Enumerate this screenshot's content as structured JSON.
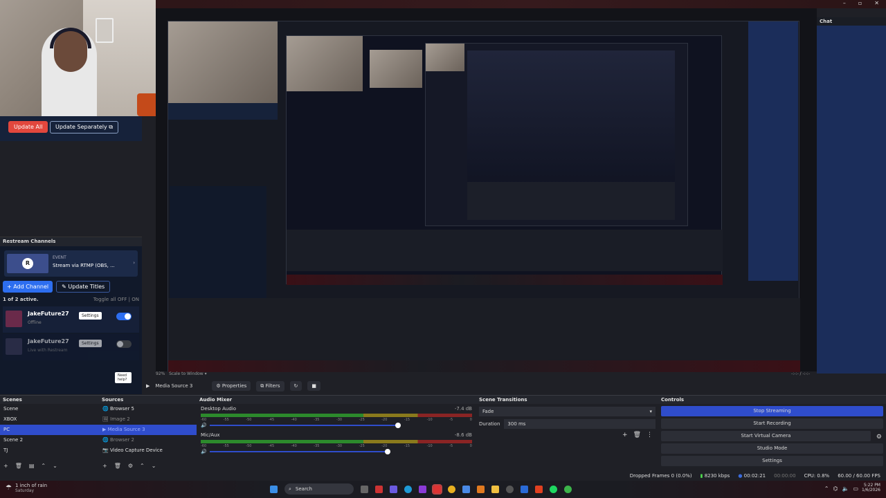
{
  "window": {
    "min": "–",
    "max": "▫",
    "close": "✕"
  },
  "update": {
    "update_all": "Update All",
    "update_separately": "Update Separately ⧉"
  },
  "restream": {
    "title": "Restream Channels",
    "event_label": "EVENT",
    "event_title": "Stream via RTMP (OBS, ...",
    "add_channel": "+ Add Channel",
    "update_titles": "✎ Update Titles",
    "active_count": "1 of 2 active.",
    "toggle_all": "Toggle all",
    "toggle_off": "OFF",
    "toggle_on": "ON",
    "channels": [
      {
        "name": "JakeFuture27",
        "status": "Offline",
        "settings": "Settings",
        "enabled": true
      },
      {
        "name": "JakeFuture27",
        "status": "Live with Restream",
        "settings": "Settings",
        "enabled": false
      }
    ],
    "help": "Need help?"
  },
  "chat": {
    "title": "Chat"
  },
  "toolbar": {
    "source_name": "Media Source 3",
    "properties": "Properties",
    "filters": "Filters",
    "zoom": "92%",
    "scale": "Scale to Window",
    "time": "-:-:- / -:-:-"
  },
  "scenes": {
    "title": "Scenes",
    "items": [
      "Scene",
      "XBOX",
      "PC",
      "Scene 2",
      "TJ"
    ],
    "selected": 2
  },
  "sources": {
    "title": "Sources",
    "items": [
      "Browser 5",
      "Image 2",
      "Media Source 3",
      "Browser 2",
      "Video Capture Device"
    ],
    "selected": 2
  },
  "audio": {
    "title": "Audio Mixer",
    "channels": [
      {
        "name": "Desktop Audio",
        "db": "-7.4 dB",
        "level": 0.55
      },
      {
        "name": "Mic/Aux",
        "db": "-8.6 dB",
        "level": 0.45
      }
    ],
    "ticks": [
      "-60",
      "-55",
      "-50",
      "-45",
      "-40",
      "-35",
      "-30",
      "-25",
      "-20",
      "-15",
      "-10",
      "-5",
      "0"
    ]
  },
  "transitions": {
    "title": "Scene Transitions",
    "type": "Fade",
    "duration_label": "Duration",
    "duration": "300 ms"
  },
  "controls": {
    "title": "Controls",
    "buttons": [
      "Stop Streaming",
      "Start Recording",
      "Start Virtual Camera",
      "Studio Mode",
      "Settings"
    ]
  },
  "status": {
    "dropped": "Dropped Frames 0 (0.0%)",
    "kbps": "8230 kbps",
    "stream_time": "00:02:21",
    "rec_time": "00:00:00",
    "cpu": "CPU: 0.8%",
    "fps": "60.00 / 60.00 FPS"
  },
  "taskbar": {
    "weather": "1 inch of rain",
    "day": "Saturday",
    "search": "Search",
    "time": "5:22 PM",
    "date": "1/6/2026"
  },
  "colors": {
    "accent": "#2f4dcc",
    "live": "#e2473d"
  }
}
